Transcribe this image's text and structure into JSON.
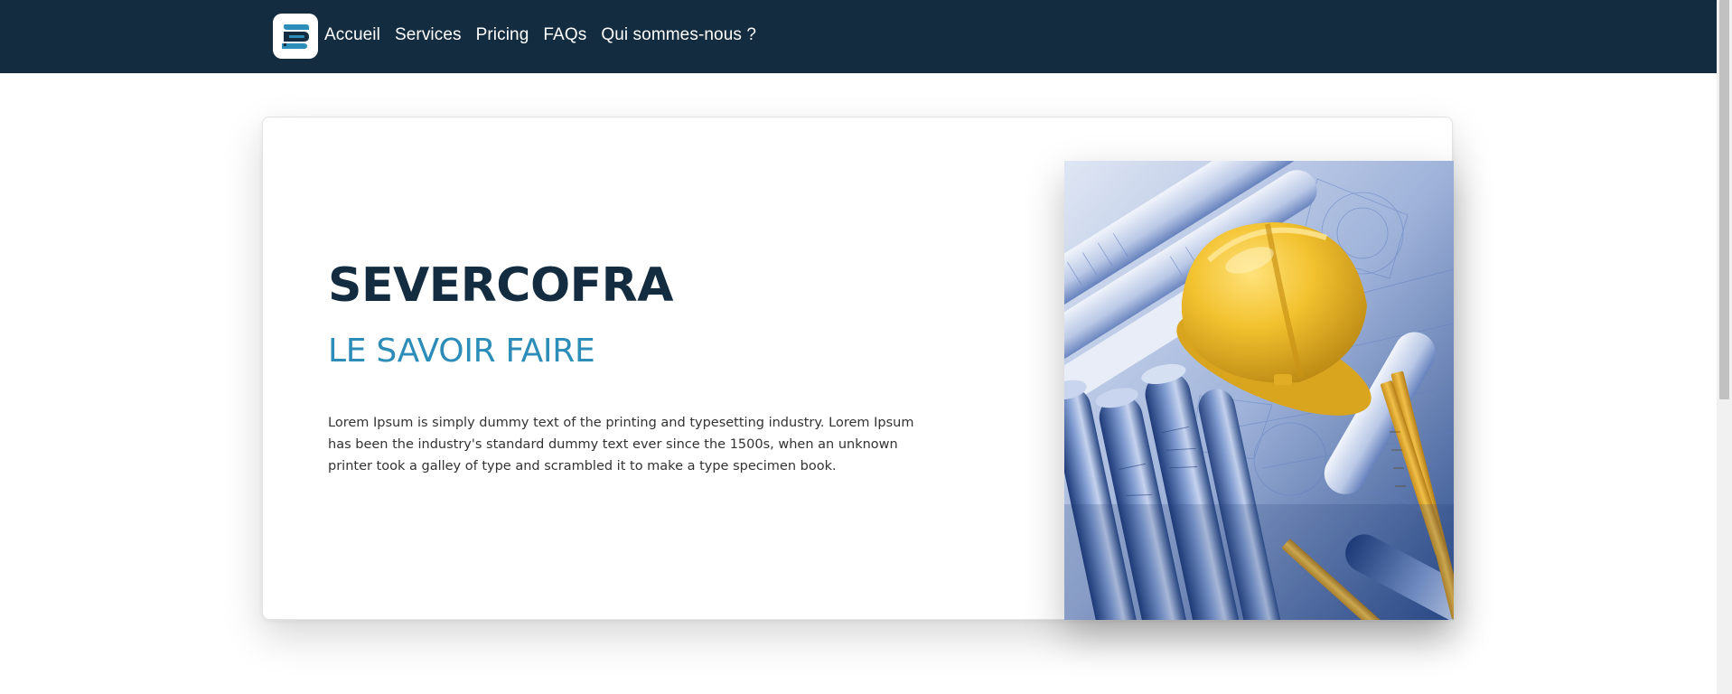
{
  "navbar": {
    "logo_icon": "severcofra-logo-icon",
    "links": [
      {
        "label": "Accueil"
      },
      {
        "label": "Services"
      },
      {
        "label": "Pricing"
      },
      {
        "label": "FAQs"
      },
      {
        "label": "Qui sommes-nous ?"
      }
    ]
  },
  "hero": {
    "title": "SEVERCOFRA",
    "subtitle": "LE SAVOIR FAIRE",
    "text": "Lorem Ipsum is simply dummy text of the printing and typesetting industry. Lorem Ipsum has been the industry's standard dummy text ever since the 1500s, when an unknown printer took a galley of type and scrambled it to make a type specimen book.",
    "image_icon": "construction-helmet-blueprints-image"
  },
  "colors": {
    "navbar_bg": "#142c40",
    "title": "#142c40",
    "subtitle": "#2c8db8",
    "helmet": "#f2c12e",
    "blueprint": "#3f63a8"
  }
}
